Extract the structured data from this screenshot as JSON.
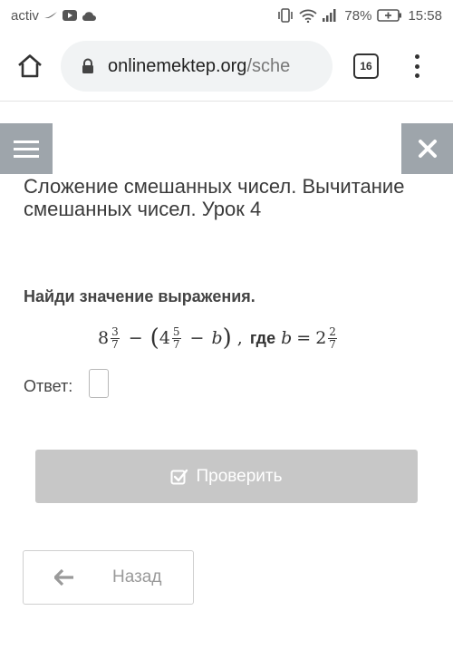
{
  "status_bar": {
    "carrier": "activ",
    "battery": "78%",
    "time": "15:58"
  },
  "browser": {
    "url_domain": "onlinemektep.org",
    "url_path": "/sche",
    "tab_count": "16"
  },
  "lesson": {
    "title": "Сложение смешанных чисел. Вычитание смешанных чисел. Урок 4"
  },
  "task": {
    "prompt": "Найди значение выражения.",
    "expression": {
      "a_whole": "8",
      "a_num": "3",
      "a_den": "7",
      "minus1": "−",
      "b_whole": "4",
      "b_num": "5",
      "b_den": "7",
      "minus2": "−",
      "var": "b",
      "comma": ",",
      "where": "где",
      "var2": "b",
      "equals": "=",
      "c_whole": "2",
      "c_num": "2",
      "c_den": "7"
    },
    "answer_label": "Ответ:",
    "answer_value": ""
  },
  "buttons": {
    "check": "Проверить",
    "back": "Назад"
  },
  "colors": {
    "side_button_bg": "#9ea5ab",
    "check_button_bg": "#c7c7c7"
  }
}
